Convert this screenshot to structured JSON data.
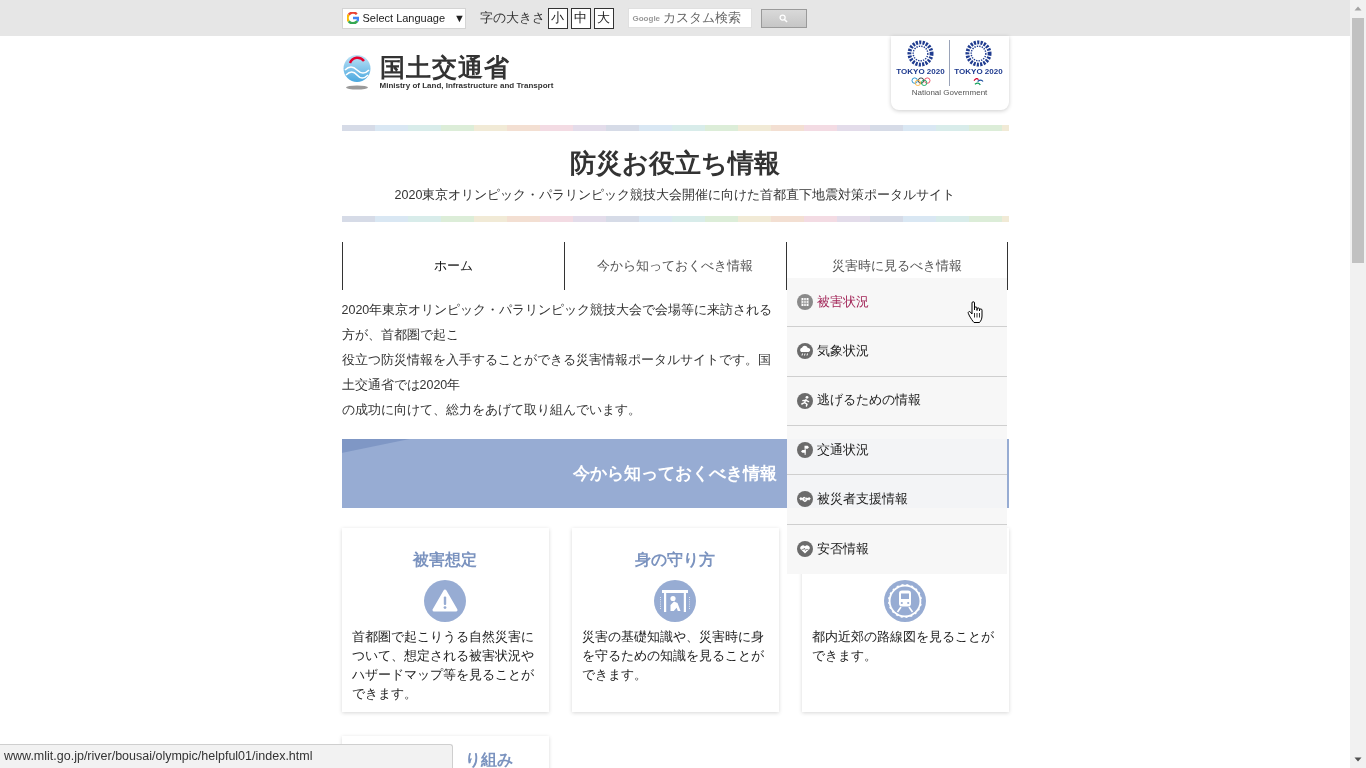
{
  "top_bar": {
    "language_select": {
      "label": "Select Language",
      "arrow": "▼"
    },
    "font_size": {
      "label": "字の大きさ",
      "options": [
        "小",
        "中",
        "大"
      ]
    },
    "search": {
      "brand": "Google",
      "placeholder": "カスタム検索"
    }
  },
  "header": {
    "logo": {
      "name": "国土交通省",
      "subtitle": "Ministry of Land, Infrastructure and Transport"
    },
    "emblem_card": {
      "captions": [
        "TOKYO 2020",
        "TOKYO 2020"
      ],
      "footer": "National Government"
    }
  },
  "site_title": {
    "heading": "防災お役立ち情報",
    "subheading": "2020東京オリンピック・パラリンピック競技大会開催に向けた首都直下地震対策ポータルサイト"
  },
  "nav": {
    "items": [
      {
        "label": "ホーム",
        "selected": true
      },
      {
        "label": "今から知っておくべき情報",
        "selected": false
      },
      {
        "label": "災害時に見るべき情報",
        "selected": false,
        "children": [
          {
            "label": "被害状況",
            "selected": true
          },
          {
            "label": "気象状況",
            "selected": false
          },
          {
            "label": "逃げるための情報",
            "selected": false
          },
          {
            "label": "交通状況",
            "selected": false
          },
          {
            "label": "被災者支援情報",
            "selected": false
          },
          {
            "label": "安否情報",
            "selected": false
          }
        ]
      }
    ]
  },
  "intro": {
    "lines": [
      "2020年東京オリンピック・パラリンピック競技大会で会場等に来訪される方が、首都圏で起こ",
      "役立つ防災情報を入手することができる災害情報ポータルサイトです。国土交通省では2020年",
      "の成功に向けて、総力をあげて取り組んでいます。"
    ]
  },
  "section": {
    "heading": "今から知っておくべき情報",
    "cards": [
      {
        "title": "被害想定",
        "description": "首都圏で起こりうる自然災害について、想定される被害状況やハザードマップ等を見ることができます。"
      },
      {
        "title": "身の守り方",
        "description": "災害の基礎知識や、災害時に身を守るための知識を見ることができます。"
      },
      {
        "description": "都内近郊の路線図を見ることができます。"
      },
      {
        "title": "り組み"
      }
    ]
  },
  "status_bar": {
    "url": "www.mlit.go.jp/river/bousai/olympic/helpful01/index.html"
  }
}
